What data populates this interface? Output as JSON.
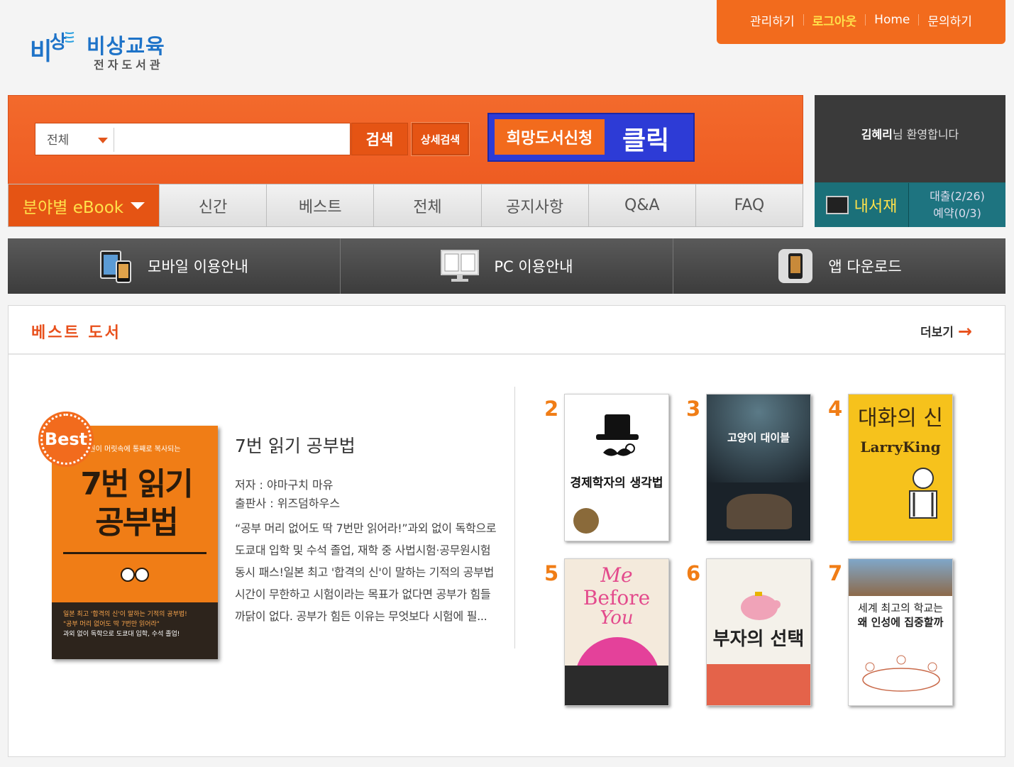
{
  "header": {
    "brand": "비상교육",
    "sub": "전자도서관",
    "logo_letters": "VISANG",
    "menu": [
      {
        "label": "관리하기",
        "highlight": false
      },
      {
        "label": "로그아웃",
        "highlight": true
      },
      {
        "label": "Home",
        "highlight": false
      },
      {
        "label": "문의하기",
        "highlight": false
      }
    ]
  },
  "search": {
    "scope": "전체",
    "query": "",
    "search_label": "검색",
    "advanced_label": "상세검색",
    "wish_label": "희망도서신청",
    "callout_label": "클릭"
  },
  "nav": {
    "category_label": "분야별 eBook",
    "tabs": [
      "신간",
      "베스트",
      "전체",
      "공지사항",
      "Q&A",
      "FAQ"
    ]
  },
  "user": {
    "name": "김혜리",
    "greeting": "님 환영합니다",
    "shelf_label": "내서재",
    "loan": "대출(2/26)",
    "reserve": "예약(0/3)"
  },
  "guide": [
    {
      "label": "모바일 이용안내",
      "icon": "mobile-devices-icon"
    },
    {
      "label": "PC 이용안내",
      "icon": "monitor-icon"
    },
    {
      "label": "앱 다운로드",
      "icon": "app-phone-icon"
    }
  ],
  "best": {
    "title": "베스트 도서",
    "more_label": "더보기",
    "badge": "Best",
    "featured": {
      "title": "7번 읽기 공부법",
      "author": "저자 : 야마구치 마유",
      "publisher": "출판사 : 위즈덤하우스",
      "description": "“공부 머리 없어도 딱 7번만 읽어라!”과외 없이 독학으로 도쿄대 입학 및 수석 졸업, 재학 중 사법시험·공무원시험 동시 패스!일본 최고 '합격의 신'이 말하는 기적의 공부법시간이 무한하고 시험이라는 목표가 없다면 공부가 힘들 까닭이 없다. 공부가 힘든 이유는 무엇보다 시험에 필...",
      "cover_top": "권이 머릿속에 통째로 복사되는",
      "cover_title_1": "7번 읽기",
      "cover_title_2": "공부법",
      "cover_bottom_1": "일본 최고 '합격의 신'이 말하는 기적의 공부법!",
      "cover_bottom_2": "\"공부 머리 없어도 딱 7번만 읽어라\"",
      "cover_bottom_3": "과외 없이 독학으로 도쿄대 입학, 수석 졸업!"
    },
    "books": [
      {
        "rank": "2",
        "cover_text": "경제학자의 생각법"
      },
      {
        "rank": "3",
        "cover_text": "고양이 대이블"
      },
      {
        "rank": "4",
        "cover_text_1": "대화의 신",
        "cover_text_2": "LarryKing"
      },
      {
        "rank": "5",
        "cover_text_1": "Me",
        "cover_text_2": "Before",
        "cover_text_3": "You"
      },
      {
        "rank": "6",
        "cover_text": "부자의 선택"
      },
      {
        "rank": "7",
        "cover_text_1": "세계 최고의 학교는",
        "cover_text_2": "왜 인성에 집중할까"
      }
    ]
  }
}
